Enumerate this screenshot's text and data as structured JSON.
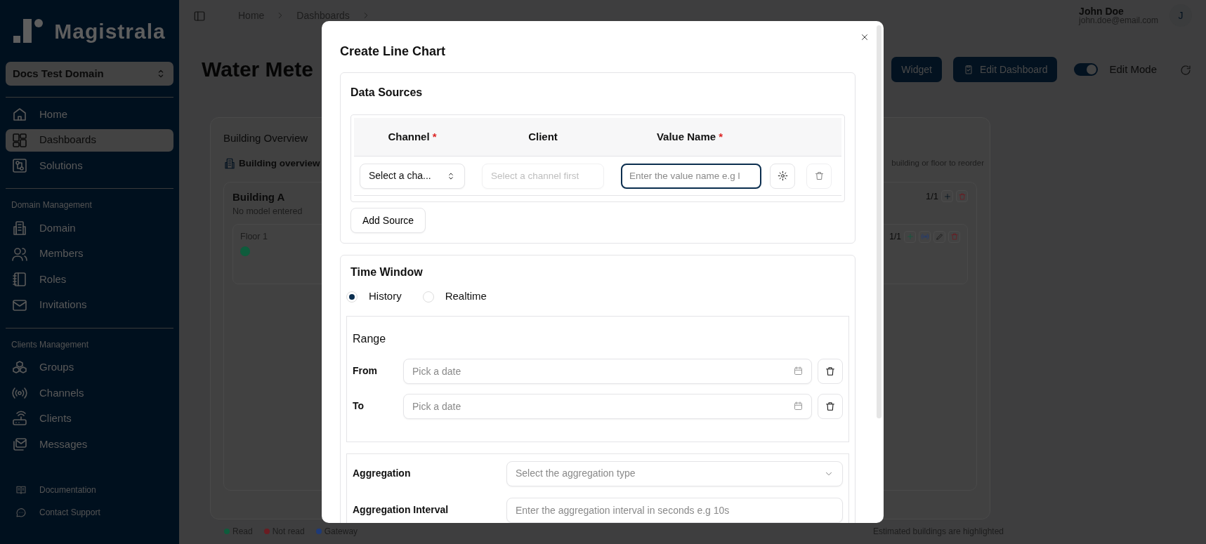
{
  "sidebar": {
    "logo": "Magistrala",
    "domain": "Docs Test Domain",
    "sections": [
      {
        "items": [
          {
            "label": "Home",
            "selected": false
          },
          {
            "label": "Dashboards",
            "selected": true
          },
          {
            "label": "Solutions",
            "selected": false
          }
        ]
      },
      {
        "title": "Domain Management",
        "items": [
          {
            "label": "Domain",
            "selected": false
          },
          {
            "label": "Members",
            "selected": false
          },
          {
            "label": "Roles",
            "selected": false
          },
          {
            "label": "Invitations",
            "selected": false
          }
        ]
      },
      {
        "title": "Clients Management",
        "items": [
          {
            "label": "Groups",
            "selected": false
          },
          {
            "label": "Channels",
            "selected": false
          },
          {
            "label": "Clients",
            "selected": false
          },
          {
            "label": "Messages",
            "selected": false
          }
        ]
      }
    ],
    "footer_links": [
      {
        "label": "Documentation"
      },
      {
        "label": "Contact Support"
      }
    ]
  },
  "header": {
    "breadcrumbs": [
      "Home",
      "Dashboards"
    ],
    "user": {
      "name": "John Doe",
      "email": "john.doe@email.com",
      "initial": "J"
    }
  },
  "page": {
    "title": "Water Mete",
    "buttons": [
      "Widget",
      "Edit Dashboard"
    ],
    "edit_mode": {
      "label": "Edit Mode",
      "on": true
    }
  },
  "widget": {
    "title": "Building Overview",
    "subtitle": "Building overview",
    "hint": "building or floor to reorder",
    "buildings": [
      {
        "name": "Building A",
        "model": "No model entered",
        "count": "1/1",
        "floors": [
          {
            "name": "Floor 1",
            "count": "1/1",
            "meters": [
              {
                "color": "#0e5c3c"
              }
            ]
          }
        ]
      }
    ],
    "legend": [
      {
        "label": "Read",
        "color": "#0e5c3c"
      },
      {
        "label": "Not read",
        "color": "#6a1c22"
      },
      {
        "label": "Gateway",
        "color": "#1e3a78"
      }
    ],
    "footnote": "Estimated buildings are highlighted"
  },
  "modal": {
    "title": "Create Line Chart",
    "data_sources": {
      "title": "Data Sources",
      "columns": [
        {
          "label": "Channel",
          "marker": "*"
        },
        {
          "label": "Client"
        },
        {
          "label": "Value Name",
          "marker": "*"
        }
      ],
      "rows": [
        {
          "channel": {
            "value": "Select a cha..."
          },
          "client": {
            "placeholder": "Select a channel first",
            "disabled": true
          },
          "value_name": {
            "placeholder": "Enter the value name e.g l",
            "focused": true
          }
        }
      ],
      "add_button": "Add Source"
    },
    "time_window": {
      "title": "Time Window",
      "modes": [
        {
          "label": "History",
          "selected": true
        },
        {
          "label": "Realtime",
          "selected": false
        }
      ],
      "range": {
        "title": "Range",
        "rows": [
          {
            "label": "From",
            "placeholder": "Pick a date"
          },
          {
            "label": "To",
            "placeholder": "Pick a date"
          }
        ]
      }
    },
    "aggregation": {
      "label": "Aggregation",
      "placeholder": "Select the aggregation type"
    },
    "interval": {
      "label": "Aggregation Interval",
      "placeholder": "Enter the aggregation interval in seconds e.g 10s"
    }
  }
}
